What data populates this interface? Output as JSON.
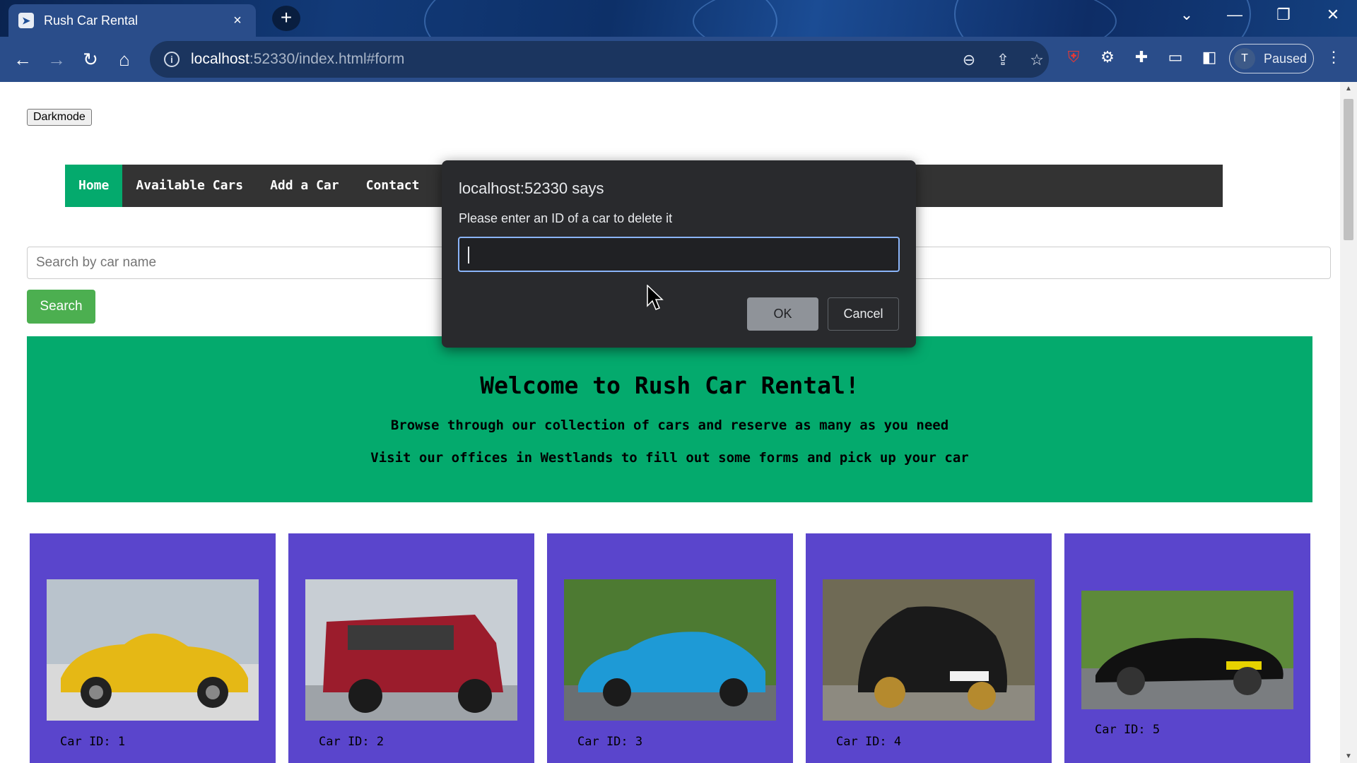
{
  "browser": {
    "tab_title": "Rush Car Rental",
    "tab_close": "×",
    "new_tab": "+",
    "url_host": "localhost",
    "url_rest": ":52330/index.html#form",
    "profile_initial": "T",
    "profile_status": "Paused"
  },
  "page": {
    "darkmode_label": "Darkmode",
    "nav": [
      "Home",
      "Available Cars",
      "Add a Car",
      "Contact"
    ],
    "search_placeholder": "Search by car name",
    "search_button": "Search",
    "hero": {
      "title": "Welcome to Rush Car Rental!",
      "line1": "Browse through our collection of cars and reserve as many as you need",
      "line2": "Visit our offices in Westlands to fill out some forms and pick up your car"
    },
    "cards": [
      {
        "id_label": "Car ID: 1",
        "color": "#e5b815"
      },
      {
        "id_label": "Car ID: 2",
        "color": "#9b1c2c"
      },
      {
        "id_label": "Car ID: 3",
        "color": "#1e9ad6"
      },
      {
        "id_label": "Car ID: 4",
        "color": "#1a1a1a"
      },
      {
        "id_label": "Car ID: 5",
        "color": "#111111"
      }
    ]
  },
  "dialog": {
    "title": "localhost:52330 says",
    "message": "Please enter an ID of a car to delete it",
    "ok": "OK",
    "cancel": "Cancel"
  }
}
